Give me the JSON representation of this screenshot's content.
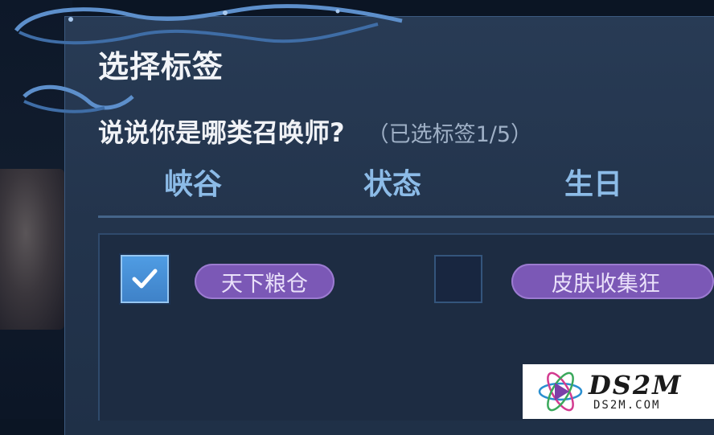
{
  "dialog": {
    "title": "选择标签",
    "question": "说说你是哪类召唤师?",
    "selected_count": "（已选标签1/5）"
  },
  "tabs": [
    {
      "label": "峡谷"
    },
    {
      "label": "状态"
    },
    {
      "label": "生日"
    }
  ],
  "tags": [
    {
      "label": "天下粮仓",
      "checked": true
    },
    {
      "label": "皮肤收集狂",
      "checked": false
    }
  ],
  "watermark": {
    "brand": "DS2M",
    "url": "DS2M.COM"
  },
  "colors": {
    "panel_bg": "#283b55",
    "tab_text": "#8cbbe7",
    "tag_bg": "#7b58b6",
    "checkbox_checked": "#4f9ce3"
  }
}
